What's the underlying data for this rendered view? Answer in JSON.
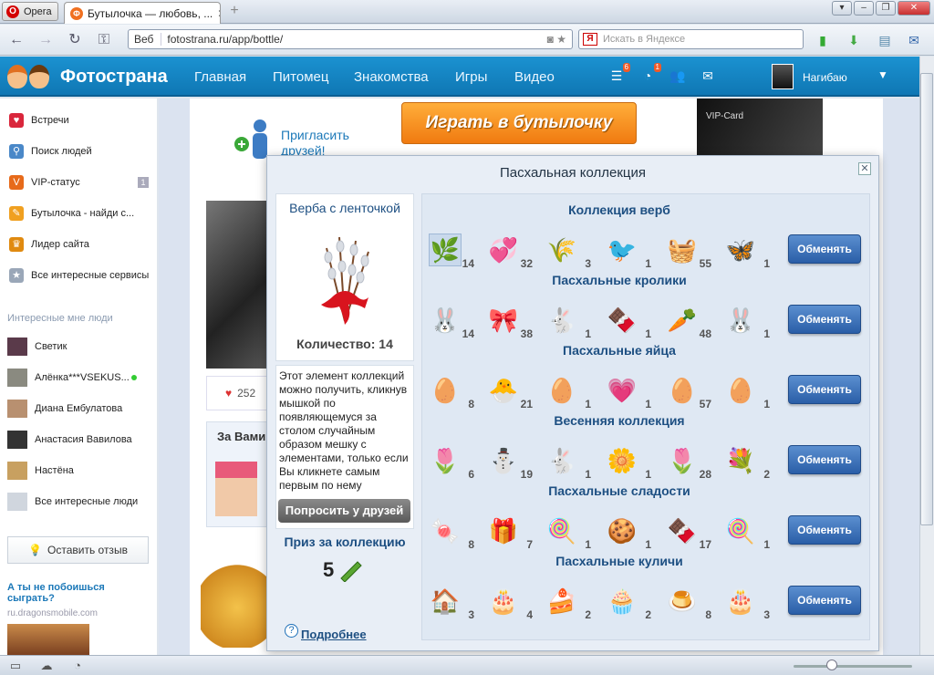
{
  "browser": {
    "opera_label": "Opera",
    "tab_title": "Бутылочка — любовь, ...",
    "url_prefix": "Веб",
    "url": "fotostrana.ru/app/bottle/",
    "search_placeholder": "Искать в Яндексе",
    "search_engine": "Я"
  },
  "header": {
    "logo": "Фотострана",
    "nav": [
      "Главная",
      "Питомец",
      "Знакомства",
      "Игры",
      "Видео"
    ],
    "badges": {
      "feed": "6",
      "notifications": "1"
    },
    "username": "Нагибаю"
  },
  "sidebar": {
    "items": [
      {
        "label": "Встречи",
        "icon": "heart-cards-icon",
        "color": "#d9263b"
      },
      {
        "label": "Поиск людей",
        "icon": "magnifier-icon",
        "color": "#4a88c8"
      },
      {
        "label": "VIP-статус",
        "icon": "vip-v-icon",
        "color": "#e76a1a",
        "count": "1"
      },
      {
        "label": "Бутылочка - найди с...",
        "icon": "bottle-icon",
        "color": "#f0a020"
      },
      {
        "label": "Лидер сайта",
        "icon": "crown-icon",
        "color": "#e08a10"
      },
      {
        "label": "Все интересные сервисы",
        "icon": "star-icon",
        "color": "#9aa7b8"
      }
    ],
    "interesting_title": "Интересные мне люди",
    "people": [
      {
        "name": "Светик",
        "color": "#5a3a4a"
      },
      {
        "name": "Алёнка***VSEKUS...",
        "color": "#8a8a80"
      },
      {
        "name": "Диана Ембулатова",
        "color": "#b89070"
      },
      {
        "name": "Анастасия Вавилова",
        "color": "#333"
      },
      {
        "name": "Настёна",
        "color": "#c8a060"
      },
      {
        "name": "Все интересные люди",
        "color": "#d0d6de"
      }
    ],
    "feedback": "Оставить отзыв",
    "ad_title": "А ты не побоишься сыграть?",
    "ad_url": "ru.dragonsmobile.com"
  },
  "page": {
    "invite": "Пригласить друзей!",
    "play_button": "Играть в бутылочку",
    "vip_card": "VIP-Card",
    "likes": "252",
    "zavami": "За Вами"
  },
  "modal": {
    "title": "Пасхальная коллекция",
    "item_title": "Верба с ленточкой",
    "quantity": "Количество: 14",
    "description": "Этот элемент коллекций можно получить, кликнув мышкой по появляющемуся за столом случайным образом мешку с элементами, только если Вы кликнете самым первым по нему",
    "ask_button": "Попросить у друзей",
    "prize_title": "Приз за коллекцию",
    "prize_value": "5",
    "more_link": "Подробнее",
    "exchange_label": "Обменять",
    "collections": [
      {
        "title": "Коллекция верб",
        "items": [
          {
            "icon": "willow-branch-icon",
            "glyph": "🌿",
            "count": "14"
          },
          {
            "icon": "willow-heart-icon",
            "glyph": "💞",
            "count": "32"
          },
          {
            "icon": "willow-vase-icon",
            "glyph": "🌾",
            "count": "3"
          },
          {
            "icon": "bird-icon",
            "glyph": "🐦",
            "count": "1"
          },
          {
            "icon": "willow-basket-icon",
            "glyph": "🧺",
            "count": "55"
          },
          {
            "icon": "butterfly-icon",
            "glyph": "🦋",
            "count": "1"
          }
        ]
      },
      {
        "title": "Пасхальные кролики",
        "items": [
          {
            "icon": "bunny-heart-icon",
            "glyph": "🐰",
            "count": "14"
          },
          {
            "icon": "bunny-ears-icon",
            "glyph": "🎀",
            "count": "38"
          },
          {
            "icon": "lying-bunny-icon",
            "glyph": "🐇",
            "count": "1"
          },
          {
            "icon": "chocolate-bunny-icon",
            "glyph": "🍫",
            "count": "1"
          },
          {
            "icon": "carrot-icon",
            "glyph": "🥕",
            "count": "48"
          },
          {
            "icon": "white-bunny-icon",
            "glyph": "🐰",
            "count": "1"
          }
        ]
      },
      {
        "title": "Пасхальные яйца",
        "items": [
          {
            "icon": "orange-egg-icon",
            "glyph": "🥚",
            "count": "8"
          },
          {
            "icon": "cracked-egg-icon",
            "glyph": "🐣",
            "count": "21"
          },
          {
            "icon": "red-egg-icon",
            "glyph": "🥚",
            "count": "1"
          },
          {
            "icon": "heart-egg-icon",
            "glyph": "💗",
            "count": "1"
          },
          {
            "icon": "striped-egg-icon",
            "glyph": "🥚",
            "count": "57"
          },
          {
            "icon": "painted-egg-icon",
            "glyph": "🥚",
            "count": "1"
          }
        ]
      },
      {
        "title": "Весенняя коллекция",
        "items": [
          {
            "icon": "boot-flowers-icon",
            "glyph": "🌷",
            "count": "6"
          },
          {
            "icon": "snowman-icon",
            "glyph": "⛄",
            "count": "19"
          },
          {
            "icon": "rabbit-icon",
            "glyph": "🐇",
            "count": "1"
          },
          {
            "icon": "daisy-icon",
            "glyph": "🌼",
            "count": "1"
          },
          {
            "icon": "tulip-icon",
            "glyph": "🌷",
            "count": "28"
          },
          {
            "icon": "flower-basket-icon",
            "glyph": "💐",
            "count": "2"
          }
        ]
      },
      {
        "title": "Пасхальные сладости",
        "items": [
          {
            "icon": "candy-icon",
            "glyph": "🍬",
            "count": "8"
          },
          {
            "icon": "gift-box-icon",
            "glyph": "🎁",
            "count": "7"
          },
          {
            "icon": "lollipop-icon",
            "glyph": "🍭",
            "count": "1"
          },
          {
            "icon": "gingerbread-icon",
            "glyph": "🍪",
            "count": "1"
          },
          {
            "icon": "chocolate-bar-icon",
            "glyph": "🍫",
            "count": "17"
          },
          {
            "icon": "swirl-lollipop-icon",
            "glyph": "🍭",
            "count": "1"
          }
        ]
      },
      {
        "title": "Пасхальные куличи",
        "items": [
          {
            "icon": "house-cake-icon",
            "glyph": "🏠",
            "count": "3"
          },
          {
            "icon": "heart-cake-icon",
            "glyph": "🎂",
            "count": "4"
          },
          {
            "icon": "cake-slices-icon",
            "glyph": "🍰",
            "count": "2"
          },
          {
            "icon": "cupcake-icon",
            "glyph": "🧁",
            "count": "2"
          },
          {
            "icon": "bundt-cake-icon",
            "glyph": "🍮",
            "count": "8"
          },
          {
            "icon": "layer-cake-icon",
            "glyph": "🎂",
            "count": "3"
          }
        ]
      }
    ]
  },
  "colors": {
    "header": "#1b88c8",
    "exchange_button": "#2f63ad",
    "accent_link": "#1d4f82"
  }
}
